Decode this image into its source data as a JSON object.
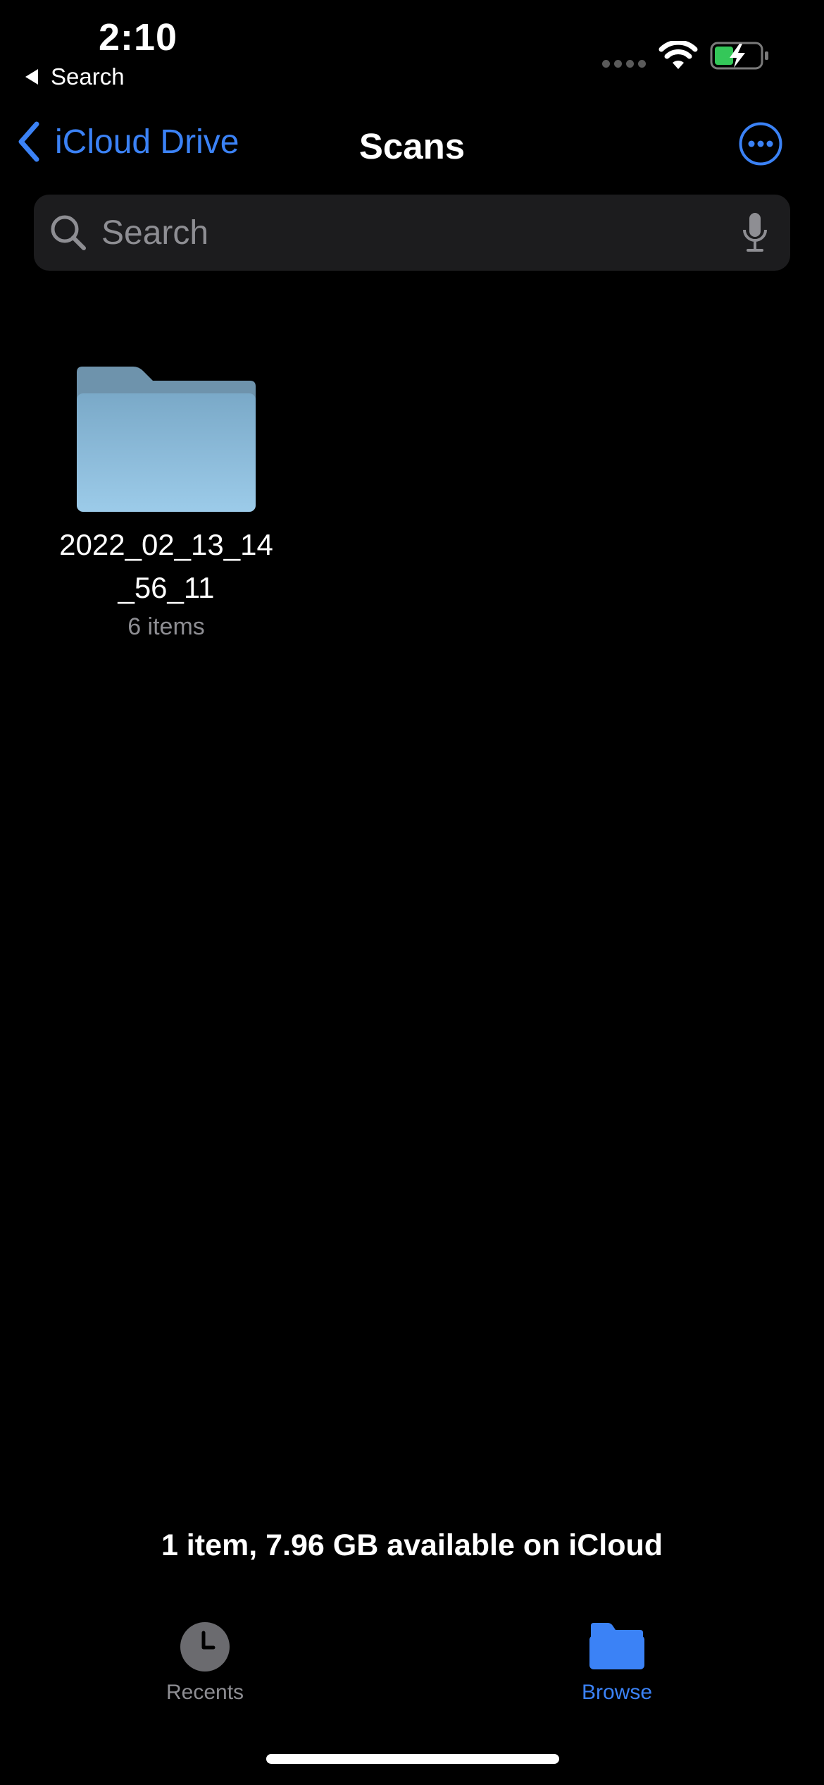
{
  "status_bar": {
    "time": "2:10",
    "back_app_label": "Search"
  },
  "nav": {
    "back_label": "iCloud Drive",
    "title": "Scans",
    "accent_color": "#3b82f6"
  },
  "search": {
    "placeholder": "Search"
  },
  "folders": [
    {
      "name": "2022_02_13_14_56_11",
      "count": "6 items",
      "icon": "folder-icon"
    }
  ],
  "footer": {
    "storage_text": "1 item, 7.96 GB available on iCloud"
  },
  "tabs": [
    {
      "label": "Recents",
      "icon": "clock-icon",
      "active": false
    },
    {
      "label": "Browse",
      "icon": "folder-icon",
      "active": true
    }
  ]
}
